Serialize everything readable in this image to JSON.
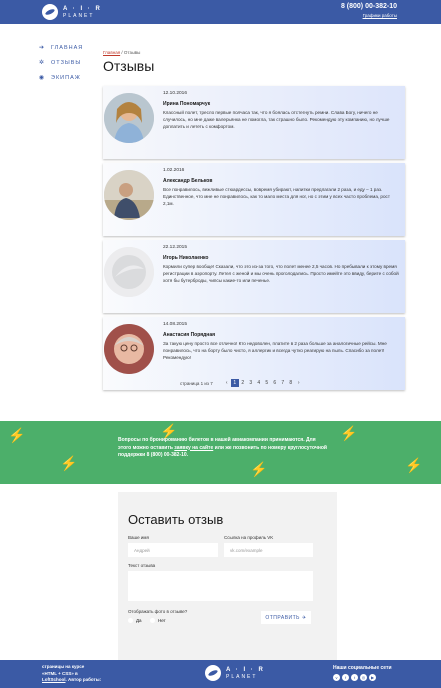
{
  "header": {
    "logo_top": "A · I · R",
    "logo_bottom": "PLANET",
    "phone": "8 (800) 00-382-10",
    "schedule_link": "Графики работы"
  },
  "nav": {
    "items": [
      {
        "label": "ГЛАВНАЯ",
        "icon": "arrow-right-icon"
      },
      {
        "label": "ОТЗЫВЫ",
        "icon": "gear-icon"
      },
      {
        "label": "ЭКИПАЖ",
        "icon": "eye-icon"
      }
    ]
  },
  "breadcrumb": {
    "home": "Главная",
    "separator": " / ",
    "current": "Отзывы"
  },
  "page_title": "Отзывы",
  "reviews": [
    {
      "date": "12.10.2016",
      "name": "Ирина Пономарчук",
      "text": "Классный полет, тресло первые полчаса так, что я боялась отстегнуть ремни. Слава Богу, ничего не случилось, но мне даже валерьянка не помогла, так страшно было. Рекомендую эту компанию, но лучше доплатить и лететь с комфортом."
    },
    {
      "date": "1.02.2016",
      "name": "Александр Бельков",
      "text": "Все понравилось, вежливые стюардессы, вовремя убирают, напитки предлагали 2 раза, и еду – 1 раз. Единственное, что мне не понравилось, как то мало места для ног, но с этим у всех часто проблема, рост 2,1м."
    },
    {
      "date": "22.12.2015",
      "name": "Игорь Николаенко",
      "text": "Кормили супер вообще! Сказали, что это из-за того, что полет менее 2,5 часов. Но пребывали к этому время регистрации в аэропорту. Летел с женой и мы очень проголодались. Просто имейте это ввиду, берите с собой хотя бы бутерброды, чипсы какие-то или печенье."
    },
    {
      "date": "14.08.2015",
      "name": "Анастасия Порядная",
      "text": "За такую цену просто все отлично! Кто недоволен, платите в 2 раза больше за аналогичные рейсы. Мне понравилось, что на борту было чисто, я аллергик и всегда чутко реагирую на пыль. Спасибо за полет! Рекомендую!"
    }
  ],
  "pager": {
    "label": "страница 1 из 7",
    "prev": "‹",
    "next": "›",
    "pages": [
      "1",
      "2",
      "3",
      "4",
      "5",
      "6",
      "7",
      "8"
    ],
    "current": "1"
  },
  "banner": {
    "line1": "Вопросы по бронированию билетов в нашей авиакомпании принимаются. Для этого можно оставить",
    "link": "заявку на сайте",
    "line2": "или же позвонить по номеру круглосуточной поддержки",
    "phone": "8 (800) 00-382-10."
  },
  "form": {
    "title": "Оставить отзыв",
    "name_label": "Ваше имя",
    "name_placeholder": "Андрей",
    "vk_label": "Ссылка на профиль VK",
    "vk_placeholder": "vk.com/example",
    "text_label": "Текст отзыва",
    "photo_label": "Отображать фото в отзыве?",
    "yes": "Да",
    "no": "Нет",
    "submit": "ОТПРАВИТЬ"
  },
  "footer": {
    "line1": "страницы на курсе",
    "line2": "«HTML + CSS» в",
    "line3_link": "LoftSchool",
    "line3_rest": ". Автор работы:",
    "social_title": "Наши социальные сети",
    "socials": [
      "vk-icon",
      "facebook-icon",
      "twitter-icon",
      "instagram-icon",
      "youtube-icon"
    ]
  },
  "colors": {
    "brand": "#3b5aa5",
    "banner": "#4caf6a",
    "accent": "#c0392b"
  }
}
